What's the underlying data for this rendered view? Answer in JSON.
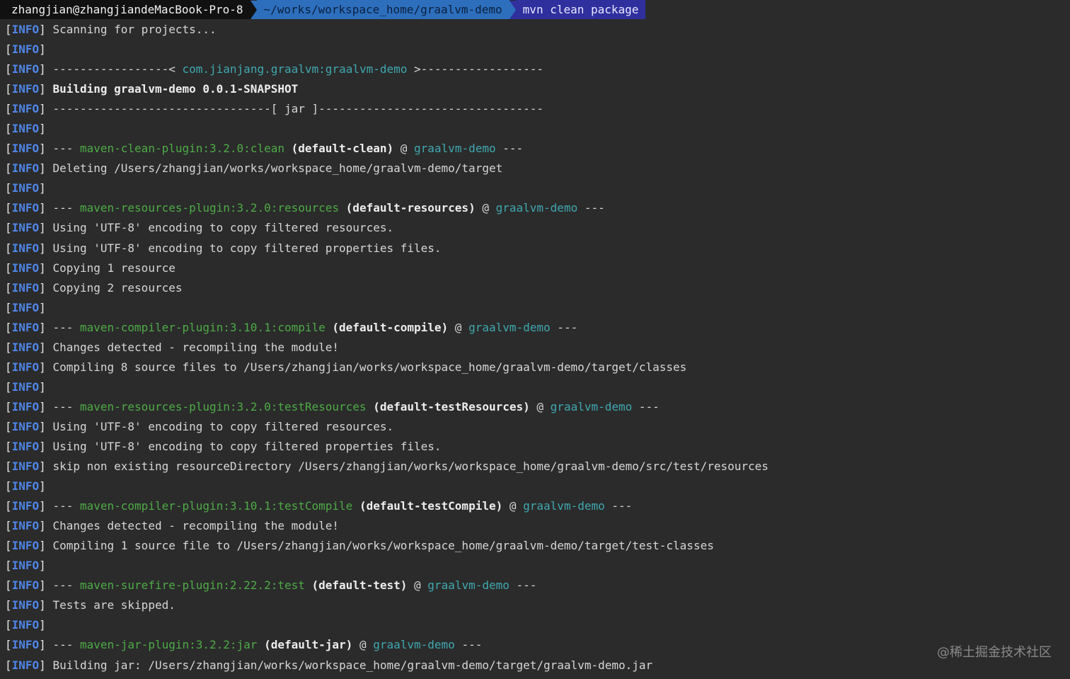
{
  "prompt": {
    "user_host": "zhangjian@zhangjiandeMacBook-Pro-8",
    "path": "~/works/workspace_home/graalvm-demo",
    "command": "mvn clean package"
  },
  "log": {
    "level": "INFO",
    "lines": [
      {
        "t": "text",
        "text": "Scanning for projects..."
      },
      {
        "t": "blank"
      },
      {
        "t": "artifact",
        "pre": "-----------------< ",
        "artifact": "com.jianjang.graalvm:graalvm-demo",
        "post": " >------------------"
      },
      {
        "t": "bold",
        "text": "Building graalvm-demo 0.0.1-SNAPSHOT"
      },
      {
        "t": "text",
        "text": "--------------------------------[ jar ]---------------------------------"
      },
      {
        "t": "blank"
      },
      {
        "t": "plugin",
        "plugin": "maven-clean-plugin:3.2.0:clean",
        "exec": "(default-clean)",
        "project": "graalvm-demo"
      },
      {
        "t": "text",
        "text": "Deleting /Users/zhangjian/works/workspace_home/graalvm-demo/target"
      },
      {
        "t": "blank"
      },
      {
        "t": "plugin",
        "plugin": "maven-resources-plugin:3.2.0:resources",
        "exec": "(default-resources)",
        "project": "graalvm-demo"
      },
      {
        "t": "text",
        "text": "Using 'UTF-8' encoding to copy filtered resources."
      },
      {
        "t": "text",
        "text": "Using 'UTF-8' encoding to copy filtered properties files."
      },
      {
        "t": "text",
        "text": "Copying 1 resource"
      },
      {
        "t": "text",
        "text": "Copying 2 resources"
      },
      {
        "t": "blank"
      },
      {
        "t": "plugin",
        "plugin": "maven-compiler-plugin:3.10.1:compile",
        "exec": "(default-compile)",
        "project": "graalvm-demo"
      },
      {
        "t": "text",
        "text": "Changes detected - recompiling the module!"
      },
      {
        "t": "text",
        "text": "Compiling 8 source files to /Users/zhangjian/works/workspace_home/graalvm-demo/target/classes"
      },
      {
        "t": "blank"
      },
      {
        "t": "plugin",
        "plugin": "maven-resources-plugin:3.2.0:testResources",
        "exec": "(default-testResources)",
        "project": "graalvm-demo"
      },
      {
        "t": "text",
        "text": "Using 'UTF-8' encoding to copy filtered resources."
      },
      {
        "t": "text",
        "text": "Using 'UTF-8' encoding to copy filtered properties files."
      },
      {
        "t": "text",
        "text": "skip non existing resourceDirectory /Users/zhangjian/works/workspace_home/graalvm-demo/src/test/resources"
      },
      {
        "t": "blank"
      },
      {
        "t": "plugin",
        "plugin": "maven-compiler-plugin:3.10.1:testCompile",
        "exec": "(default-testCompile)",
        "project": "graalvm-demo"
      },
      {
        "t": "text",
        "text": "Changes detected - recompiling the module!"
      },
      {
        "t": "text",
        "text": "Compiling 1 source file to /Users/zhangjian/works/workspace_home/graalvm-demo/target/test-classes"
      },
      {
        "t": "blank"
      },
      {
        "t": "plugin",
        "plugin": "maven-surefire-plugin:2.22.2:test",
        "exec": "(default-test)",
        "project": "graalvm-demo"
      },
      {
        "t": "text",
        "text": "Tests are skipped."
      },
      {
        "t": "blank"
      },
      {
        "t": "plugin",
        "plugin": "maven-jar-plugin:3.2.2:jar",
        "exec": "(default-jar)",
        "project": "graalvm-demo"
      },
      {
        "t": "text",
        "text": "Building jar: /Users/zhangjian/works/workspace_home/graalvm-demo/target/graalvm-demo.jar"
      }
    ]
  },
  "watermark": "@稀土掘金技术社区",
  "colors": {
    "background": "#2b2b2b",
    "level": "#4f86e8",
    "plugin": "#4eab47",
    "project": "#3fa8b0",
    "prompt_user_bg": "#111111",
    "prompt_path_bg": "#2d6fbd",
    "prompt_cmd_bg": "#2f2f9e"
  }
}
